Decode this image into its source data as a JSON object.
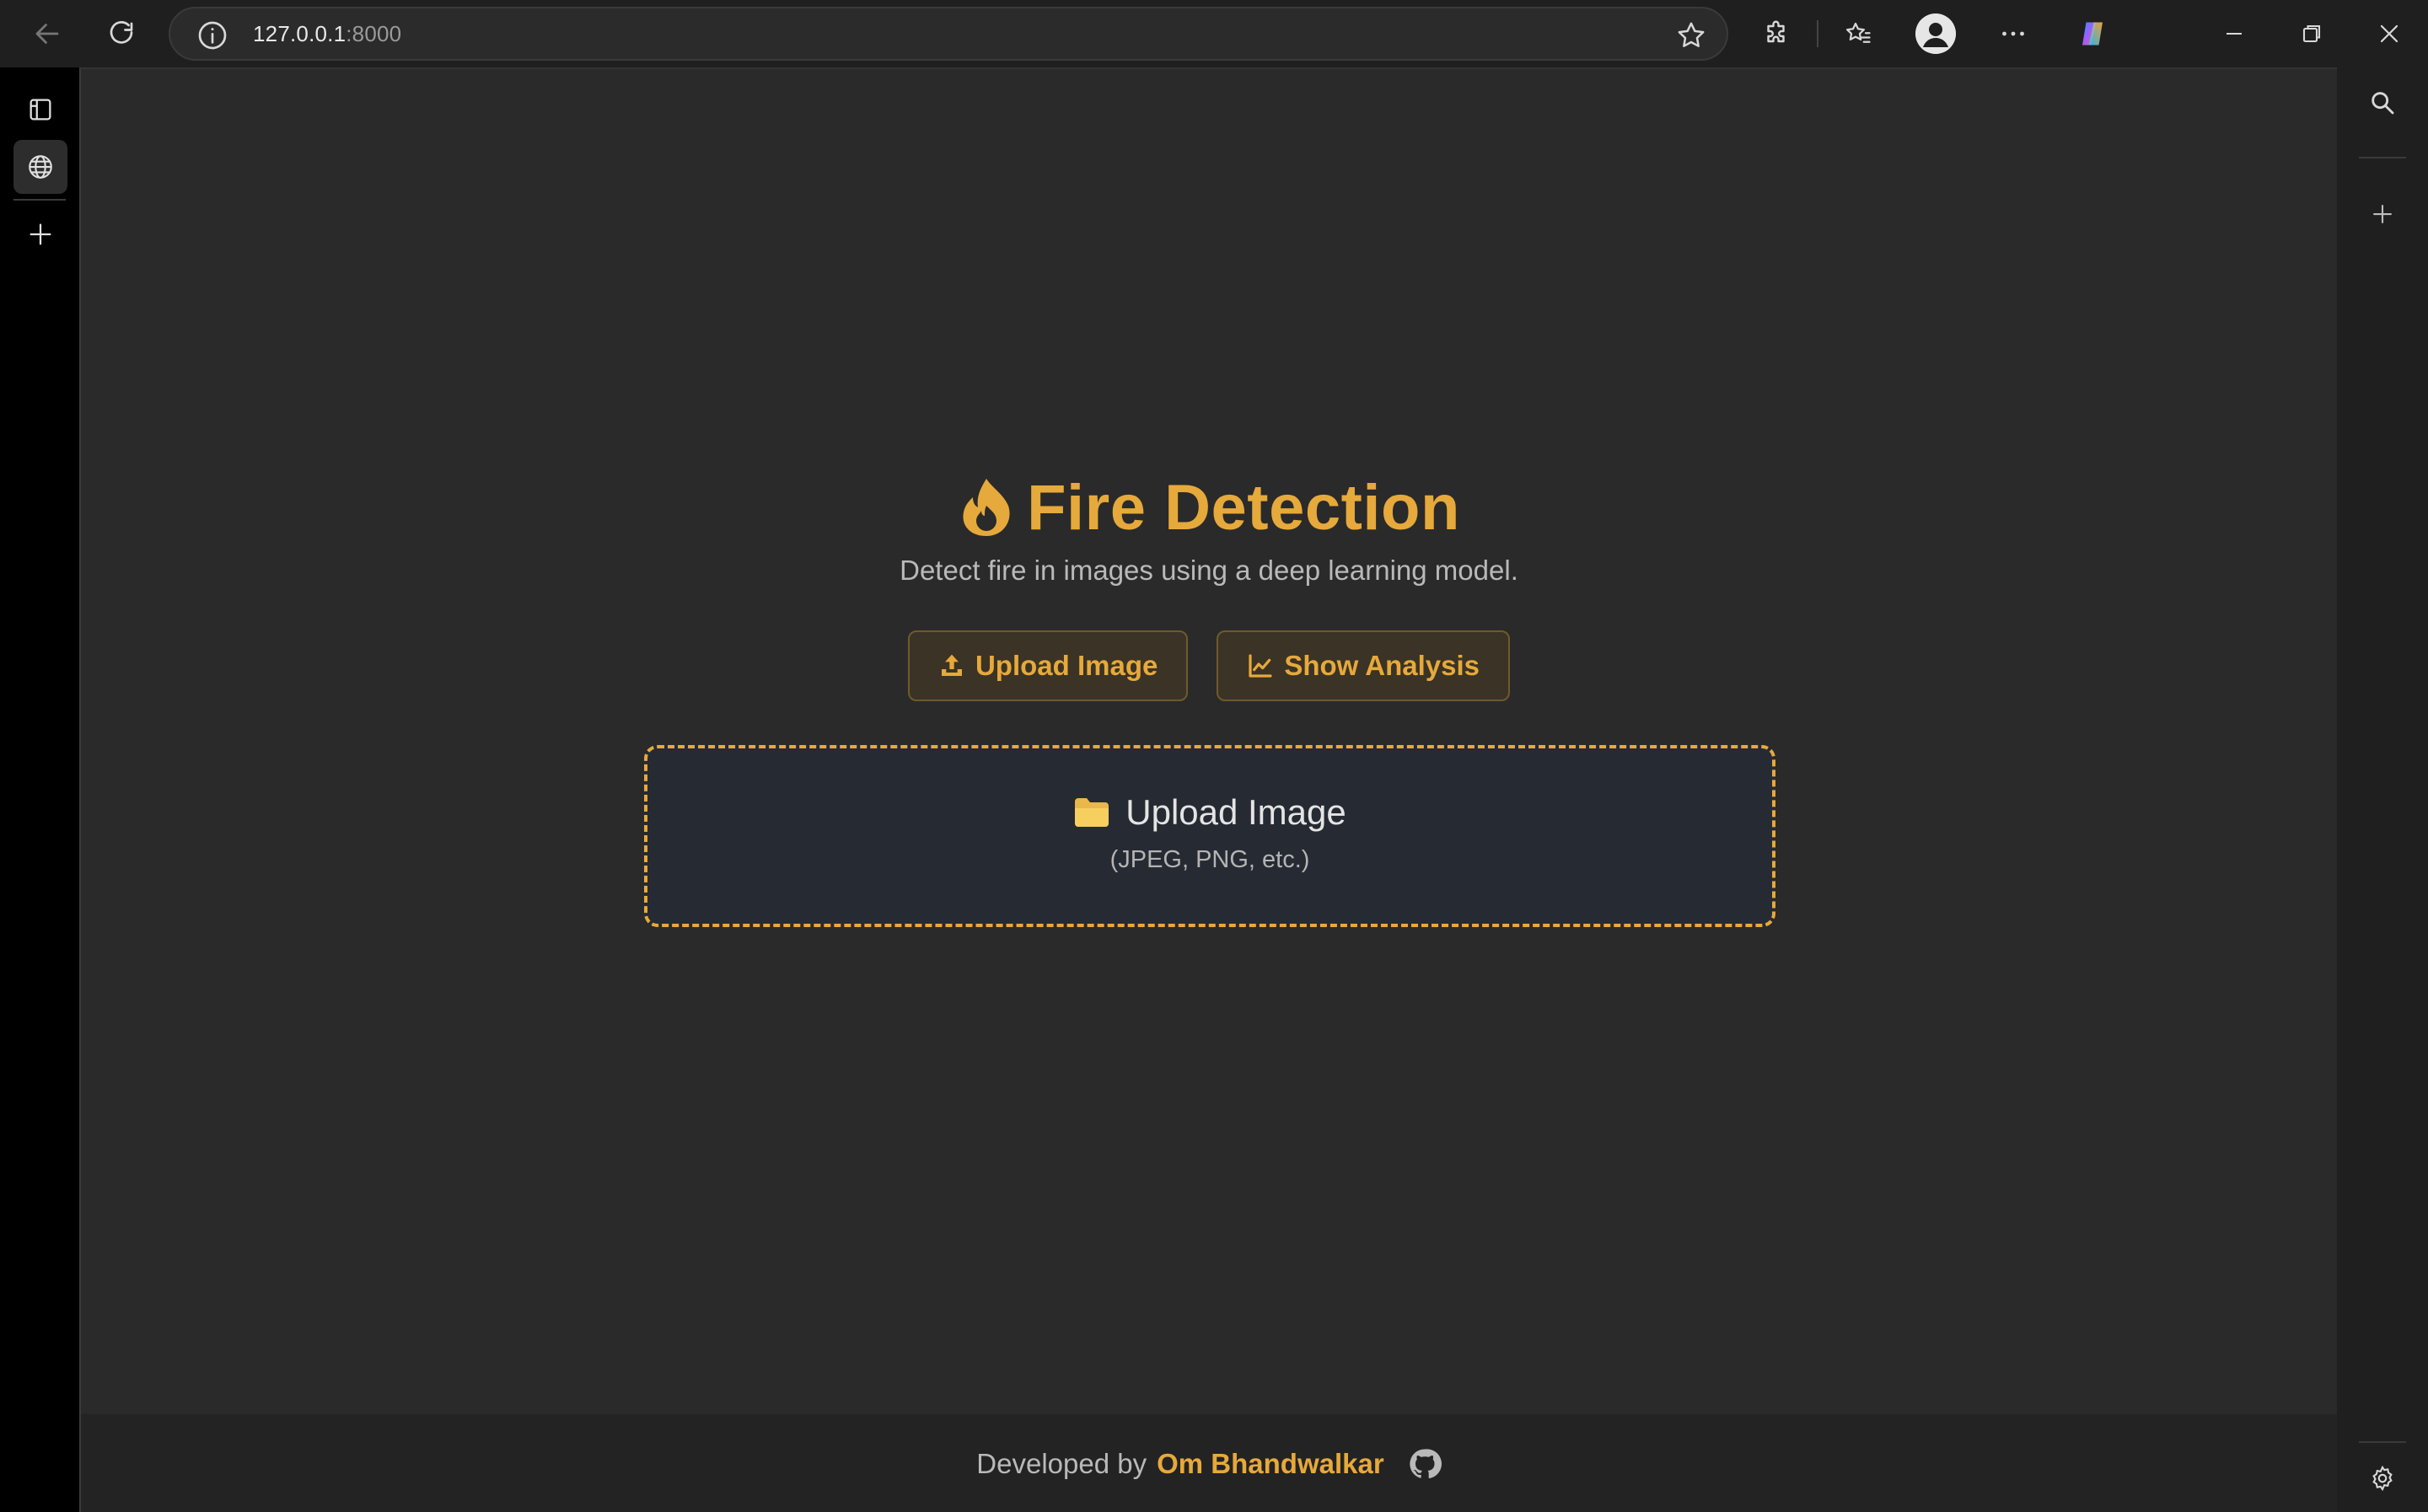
{
  "browser": {
    "url_host": "127.0.0.1",
    "url_port": ":8000"
  },
  "page": {
    "title": "Fire Detection",
    "subtitle": "Detect fire in images using a deep learning model.",
    "buttons": {
      "upload": "Upload Image",
      "analysis": "Show Analysis"
    },
    "dropzone": {
      "label": "Upload Image",
      "hint": "(JPEG, PNG, etc.)"
    },
    "footer": {
      "prefix": "Developed by",
      "author": "Om Bhandwalkar"
    }
  },
  "colors": {
    "accent": "#e6a93b",
    "background": "#2a2a2a",
    "dropzone_bg": "#262a33"
  },
  "icons": [
    "back-icon",
    "refresh-icon",
    "info-icon",
    "star-icon",
    "extensions-icon",
    "favorites-icon",
    "profile-icon",
    "more-icon",
    "copilot-icon",
    "minimize-icon",
    "restore-icon",
    "close-icon",
    "tab-actions-icon",
    "globe-icon",
    "plus-icon",
    "search-icon",
    "settings-icon",
    "flame-icon",
    "upload-icon",
    "chart-line-icon",
    "folder-icon",
    "github-icon"
  ]
}
